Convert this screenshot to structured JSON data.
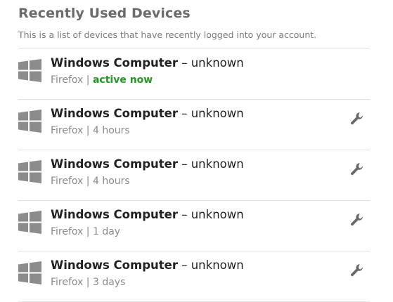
{
  "header": {
    "title": "Recently Used Devices",
    "subtitle": "This is a list of devices that have recently logged into your account."
  },
  "colors": {
    "active_status": "#1f9a1f",
    "muted_text": "#8a8a8a",
    "icon_gray": "#8c8c8c"
  },
  "devices": [
    {
      "name": "Windows Computer",
      "separator": " – ",
      "location": "unknown",
      "browser": "Firefox",
      "divider": " | ",
      "last_active": "active now",
      "is_active": true,
      "icon": "windows-icon",
      "action_icon": ""
    },
    {
      "name": "Windows Computer",
      "separator": " – ",
      "location": "unknown",
      "browser": "Firefox",
      "divider": " | ",
      "last_active": "4 hours",
      "is_active": false,
      "icon": "windows-icon",
      "action_icon": "wrench-icon"
    },
    {
      "name": "Windows Computer",
      "separator": " – ",
      "location": "unknown",
      "browser": "Firefox",
      "divider": " | ",
      "last_active": "4 hours",
      "is_active": false,
      "icon": "windows-icon",
      "action_icon": "wrench-icon"
    },
    {
      "name": "Windows Computer",
      "separator": " – ",
      "location": "unknown",
      "browser": "Firefox",
      "divider": " | ",
      "last_active": "1 day",
      "is_active": false,
      "icon": "windows-icon",
      "action_icon": "wrench-icon"
    },
    {
      "name": "Windows Computer",
      "separator": " – ",
      "location": "unknown",
      "browser": "Firefox",
      "divider": " | ",
      "last_active": "3 days",
      "is_active": false,
      "icon": "windows-icon",
      "action_icon": "wrench-icon"
    }
  ]
}
